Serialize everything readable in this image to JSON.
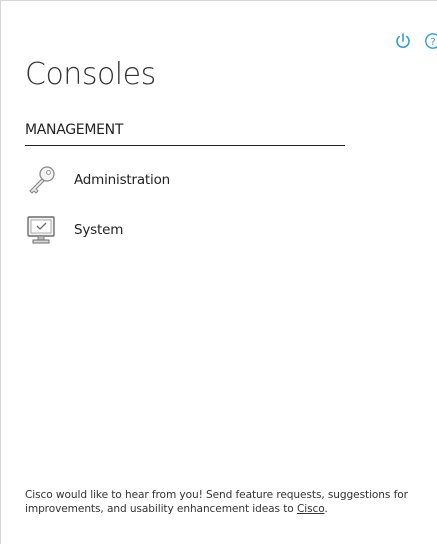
{
  "title": "Consoles",
  "section": {
    "header": "MANAGEMENT",
    "items": [
      {
        "label": "Administration",
        "icon": "key-icon"
      },
      {
        "label": "System",
        "icon": "monitor-icon"
      }
    ]
  },
  "top_icons": [
    "power-icon",
    "help-icon"
  ],
  "footer": {
    "text": "Cisco would like to hear from you! Send feature requests, suggestions for improvements, and usability enhancement ideas to",
    "link_text": "Cisco",
    "trailing": "."
  },
  "colors": {
    "accent": "#2a9fd8",
    "text": "#222222",
    "border": "#d6d6d6"
  }
}
